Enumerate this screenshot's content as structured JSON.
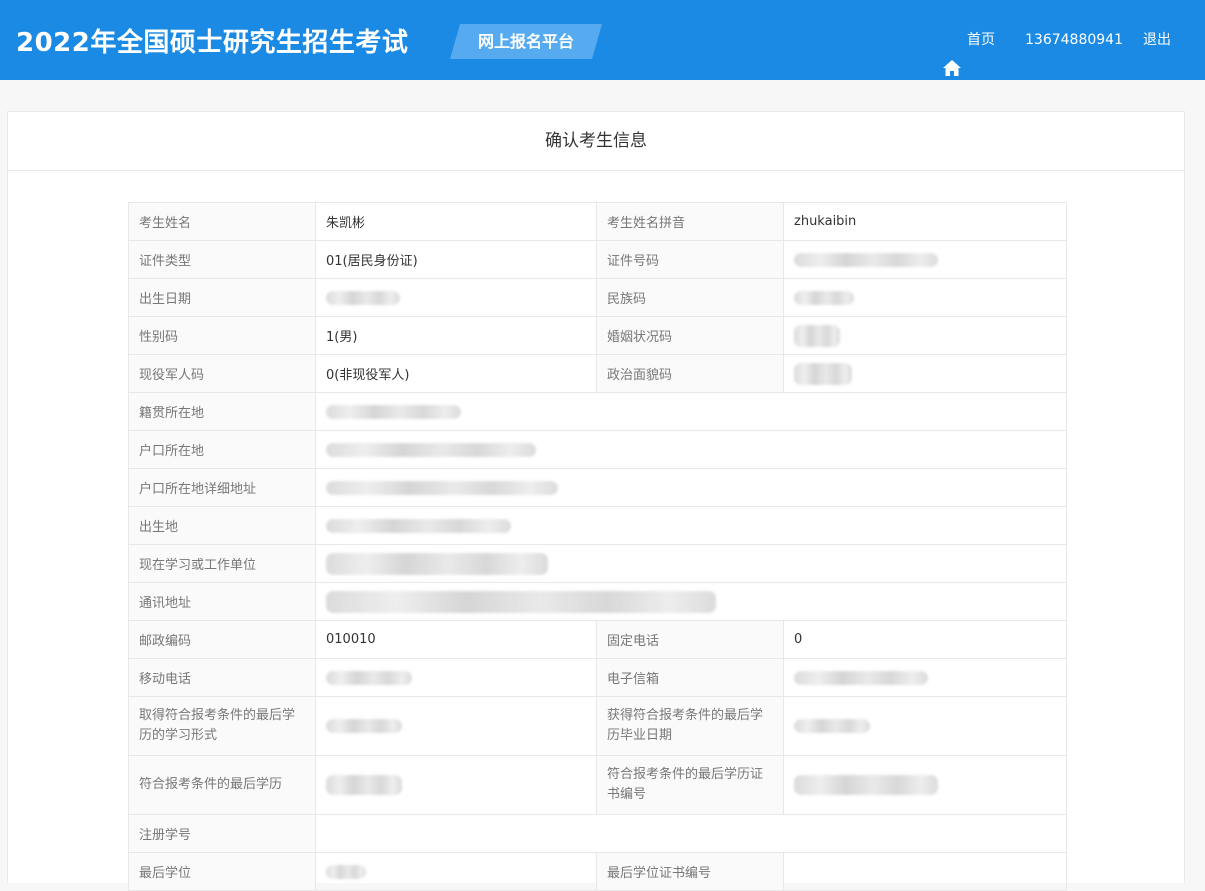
{
  "header": {
    "site_title": "2022年全国硕士研究生招生考试",
    "platform_label": "网上报名平台",
    "nav": {
      "home_label": "首页",
      "home_icon": "home-icon",
      "user_phone": "13674880941",
      "logout_label": "退出"
    },
    "colors": {
      "header_bg": "#1b8ae4",
      "badge_bg": "#56aaf0"
    }
  },
  "card": {
    "title": "确认考生信息"
  },
  "info": {
    "name": {
      "label": "考生姓名",
      "value": "朱凯彬"
    },
    "name_pinyin": {
      "label": "考生姓名拼音",
      "value": "zhukaibin"
    },
    "id_type": {
      "label": "证件类型",
      "value": "01(居民身份证)"
    },
    "id_number": {
      "label": "证件号码"
    },
    "birth_date": {
      "label": "出生日期"
    },
    "ethnicity_code": {
      "label": "民族码"
    },
    "gender_code": {
      "label": "性别码",
      "value": "1(男)"
    },
    "marital_code": {
      "label": "婚姻状况码"
    },
    "military_code": {
      "label": "现役军人码",
      "value": "0(非现役军人)"
    },
    "political_code": {
      "label": "政治面貌码"
    },
    "native_place": {
      "label": "籍贯所在地"
    },
    "hukou_location": {
      "label": "户口所在地"
    },
    "hukou_address": {
      "label": "户口所在地详细地址"
    },
    "birthplace": {
      "label": "出生地"
    },
    "work_unit": {
      "label": "现在学习或工作单位"
    },
    "mailing_address": {
      "label": "通讯地址"
    },
    "postal_code": {
      "label": "邮政编码",
      "value": "010010"
    },
    "landline": {
      "label": "固定电话",
      "value": "0"
    },
    "mobile": {
      "label": "移动电话"
    },
    "email": {
      "label": "电子信箱"
    },
    "edu_study_form": {
      "label": "取得符合报考条件的最后学历的学习形式"
    },
    "edu_grad_date": {
      "label": "获得符合报考条件的最后学历毕业日期"
    },
    "last_education": {
      "label": "符合报考条件的最后学历"
    },
    "edu_cert_number": {
      "label": "符合报考条件的最后学历证书编号"
    },
    "registration_number": {
      "label": "注册学号",
      "value": ""
    },
    "last_degree": {
      "label": "最后学位"
    },
    "degree_cert_number": {
      "label": "最后学位证书编号",
      "value": ""
    }
  }
}
